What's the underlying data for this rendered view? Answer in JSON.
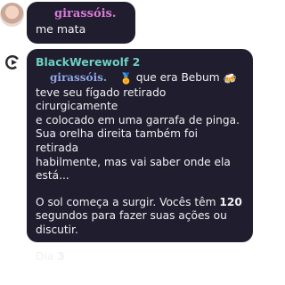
{
  "messages": [
    {
      "author": "girassóis.",
      "text": "me mata"
    },
    {
      "bot_name": "BlackWerewolf 2",
      "mention": "girassóis.",
      "line1_after_mention": " que era Bebum ",
      "line1_emoji_a": "🏅",
      "line1_emoji_b": "🍻",
      "body_lines": [
        "teve seu fígado retirado cirurgicamente",
        "e colocado em uma garrafa de pinga.",
        "Sua orelha direita também foi retirada",
        "habilmente, mas vai saber onde ela",
        "está..."
      ],
      "sun_prefix": "O sol começa a surgir. Vocês têm ",
      "seconds": "120",
      "sun_suffix_line1": "",
      "sun_line2": "segundos para fazer suas ações ou",
      "sun_line3": "discutir.",
      "day_label": "Dia ",
      "day_number": "3"
    }
  ],
  "colors": {
    "bubble_bg": "#1f1d2e",
    "username_pink": "#d97ad8",
    "bot_name_teal": "#6cd0c2",
    "mention_blue": "#8fa6e6",
    "text": "#f1f1f4"
  }
}
